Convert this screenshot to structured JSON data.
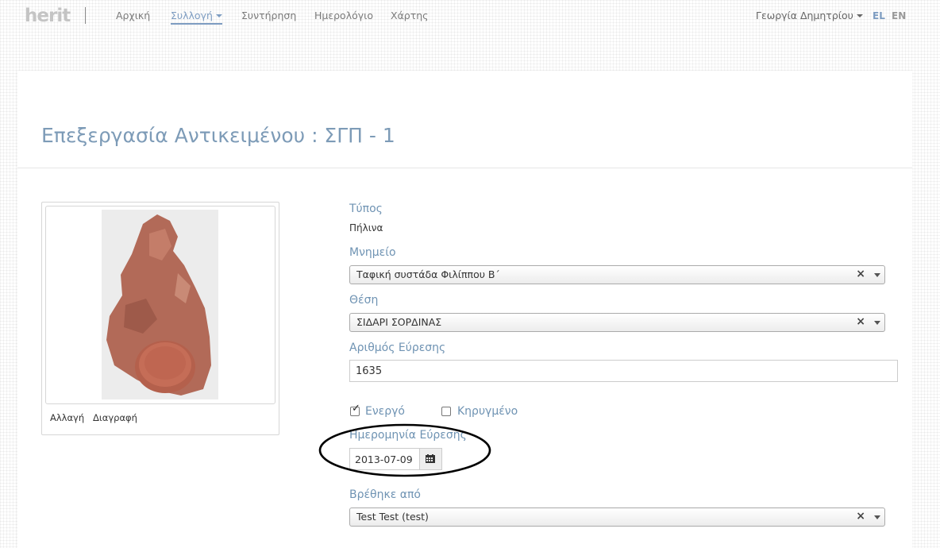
{
  "brand": {
    "logo_text": "herit"
  },
  "nav": {
    "items": [
      {
        "label": "Αρχική"
      },
      {
        "label": "Συλλογή"
      },
      {
        "label": "Συντήρηση"
      },
      {
        "label": "Ημερολόγιο"
      },
      {
        "label": "Χάρτης"
      }
    ],
    "active_item": "Συλλογή",
    "active_color": "#7d9cc1",
    "user_name": "Γεωργία Δημητρίου",
    "languages": [
      {
        "code": "EL",
        "active": true
      },
      {
        "code": "EN",
        "active": false
      }
    ]
  },
  "page": {
    "title": "Επεξεργασία Αντικειμένου : ΣΓΠ - 1"
  },
  "image_card": {
    "image_subject": "clay-artifact-photo",
    "change_label": "Αλλαγή",
    "delete_label": "Διαγραφή"
  },
  "form": {
    "type_label": "Τύπος",
    "type_value": "Πήλινα",
    "monument_label": "Μνημείο",
    "monument_value": "Ταφική συστάδα Φιλίππου Β΄",
    "location_label": "Θέση",
    "location_value": "ΣΙΔΑΡΙ ΣΟΡΔΙΝΑΣ",
    "find_number_label": "Αριθμός Εύρεσης",
    "find_number_value": "1635",
    "active_label": "Ενεργό",
    "active_checked": true,
    "declared_label": "Κηρυγμένο",
    "declared_checked": false,
    "find_date_label": "Ημερομηνία Εύρεσης",
    "find_date_value": "2013-07-09",
    "found_by_label": "Βρέθηκε από",
    "found_by_value": "Test Test (test)",
    "label_color": "#6f93b3"
  },
  "icons": {
    "calendar": "calendar-icon",
    "clear": "clear-x-icon",
    "dropdown": "dropdown-arrow-icon"
  }
}
